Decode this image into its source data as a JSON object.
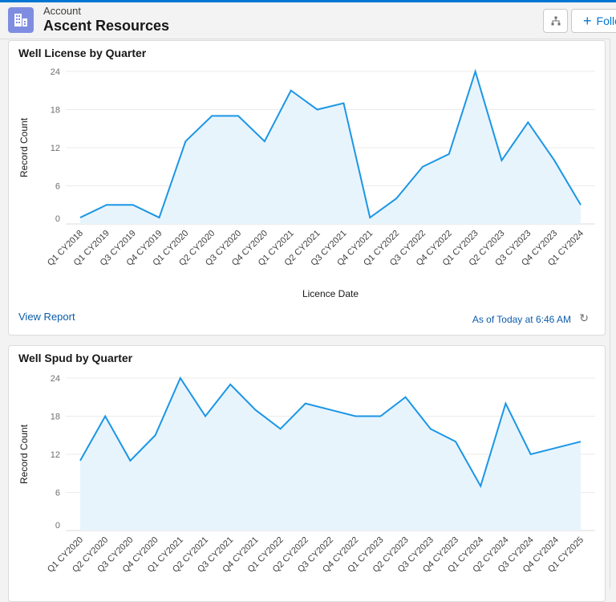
{
  "header": {
    "object_label": "Account",
    "record_title": "Ascent Resources",
    "icon": "account-building-icon",
    "hierarchy_button_icon": "hierarchy-icon",
    "follow_label": "Follow"
  },
  "colors": {
    "accent": "#0176d3",
    "series": "#1b96e6",
    "area": "#e8f4fc",
    "icon_bg": "#7f8de1"
  },
  "cards": [
    {
      "title": "Well License by Quarter",
      "view_report": "View Report",
      "as_of": "As of Today at 6:46 AM",
      "refresh_icon": "refresh-icon"
    },
    {
      "title": "Well Spud by Quarter"
    }
  ],
  "chart_data": [
    {
      "type": "area",
      "title": "Well License by Quarter",
      "xlabel": "Licence Date",
      "ylabel": "Record Count",
      "ylim": [
        0,
        24
      ],
      "yticks": [
        0,
        6,
        12,
        18,
        24
      ],
      "grid": true,
      "categories": [
        "Q1 CY2018",
        "Q1 CY2019",
        "Q3 CY2019",
        "Q4 CY2019",
        "Q1 CY2020",
        "Q2 CY2020",
        "Q3 CY2020",
        "Q4 CY2020",
        "Q1 CY2021",
        "Q2 CY2021",
        "Q3 CY2021",
        "Q4 CY2021",
        "Q1 CY2022",
        "Q3 CY2022",
        "Q4 CY2022",
        "Q1 CY2023",
        "Q2 CY2023",
        "Q3 CY2023",
        "Q4 CY2023",
        "Q1 CY2024"
      ],
      "values": [
        1,
        3,
        3,
        1,
        13,
        17,
        17,
        13,
        21,
        18,
        19,
        1,
        4,
        9,
        11,
        24,
        10,
        16,
        10,
        3
      ]
    },
    {
      "type": "area",
      "title": "Well Spud by Quarter",
      "ylabel": "Record Count",
      "ylim": [
        0,
        24
      ],
      "yticks": [
        0,
        6,
        12,
        18,
        24
      ],
      "grid": true,
      "categories": [
        "Q1 CY2020",
        "Q2 CY2020",
        "Q3 CY2020",
        "Q4 CY2020",
        "Q1 CY2021",
        "Q2 CY2021",
        "Q3 CY2021",
        "Q4 CY2021",
        "Q1 CY2022",
        "Q2 CY2022",
        "Q3 CY2022",
        "Q4 CY2022",
        "Q1 CY2023",
        "Q2 CY2023",
        "Q3 CY2023",
        "Q4 CY2023",
        "Q1 CY2024",
        "Q2 CY2024",
        "Q3 CY2024",
        "Q4 CY2024",
        "Q1 CY2025"
      ],
      "values": [
        11,
        18,
        11,
        15,
        24,
        18,
        23,
        19,
        16,
        20,
        19,
        18,
        18,
        21,
        16,
        14,
        7,
        20,
        12,
        13,
        14
      ]
    }
  ]
}
